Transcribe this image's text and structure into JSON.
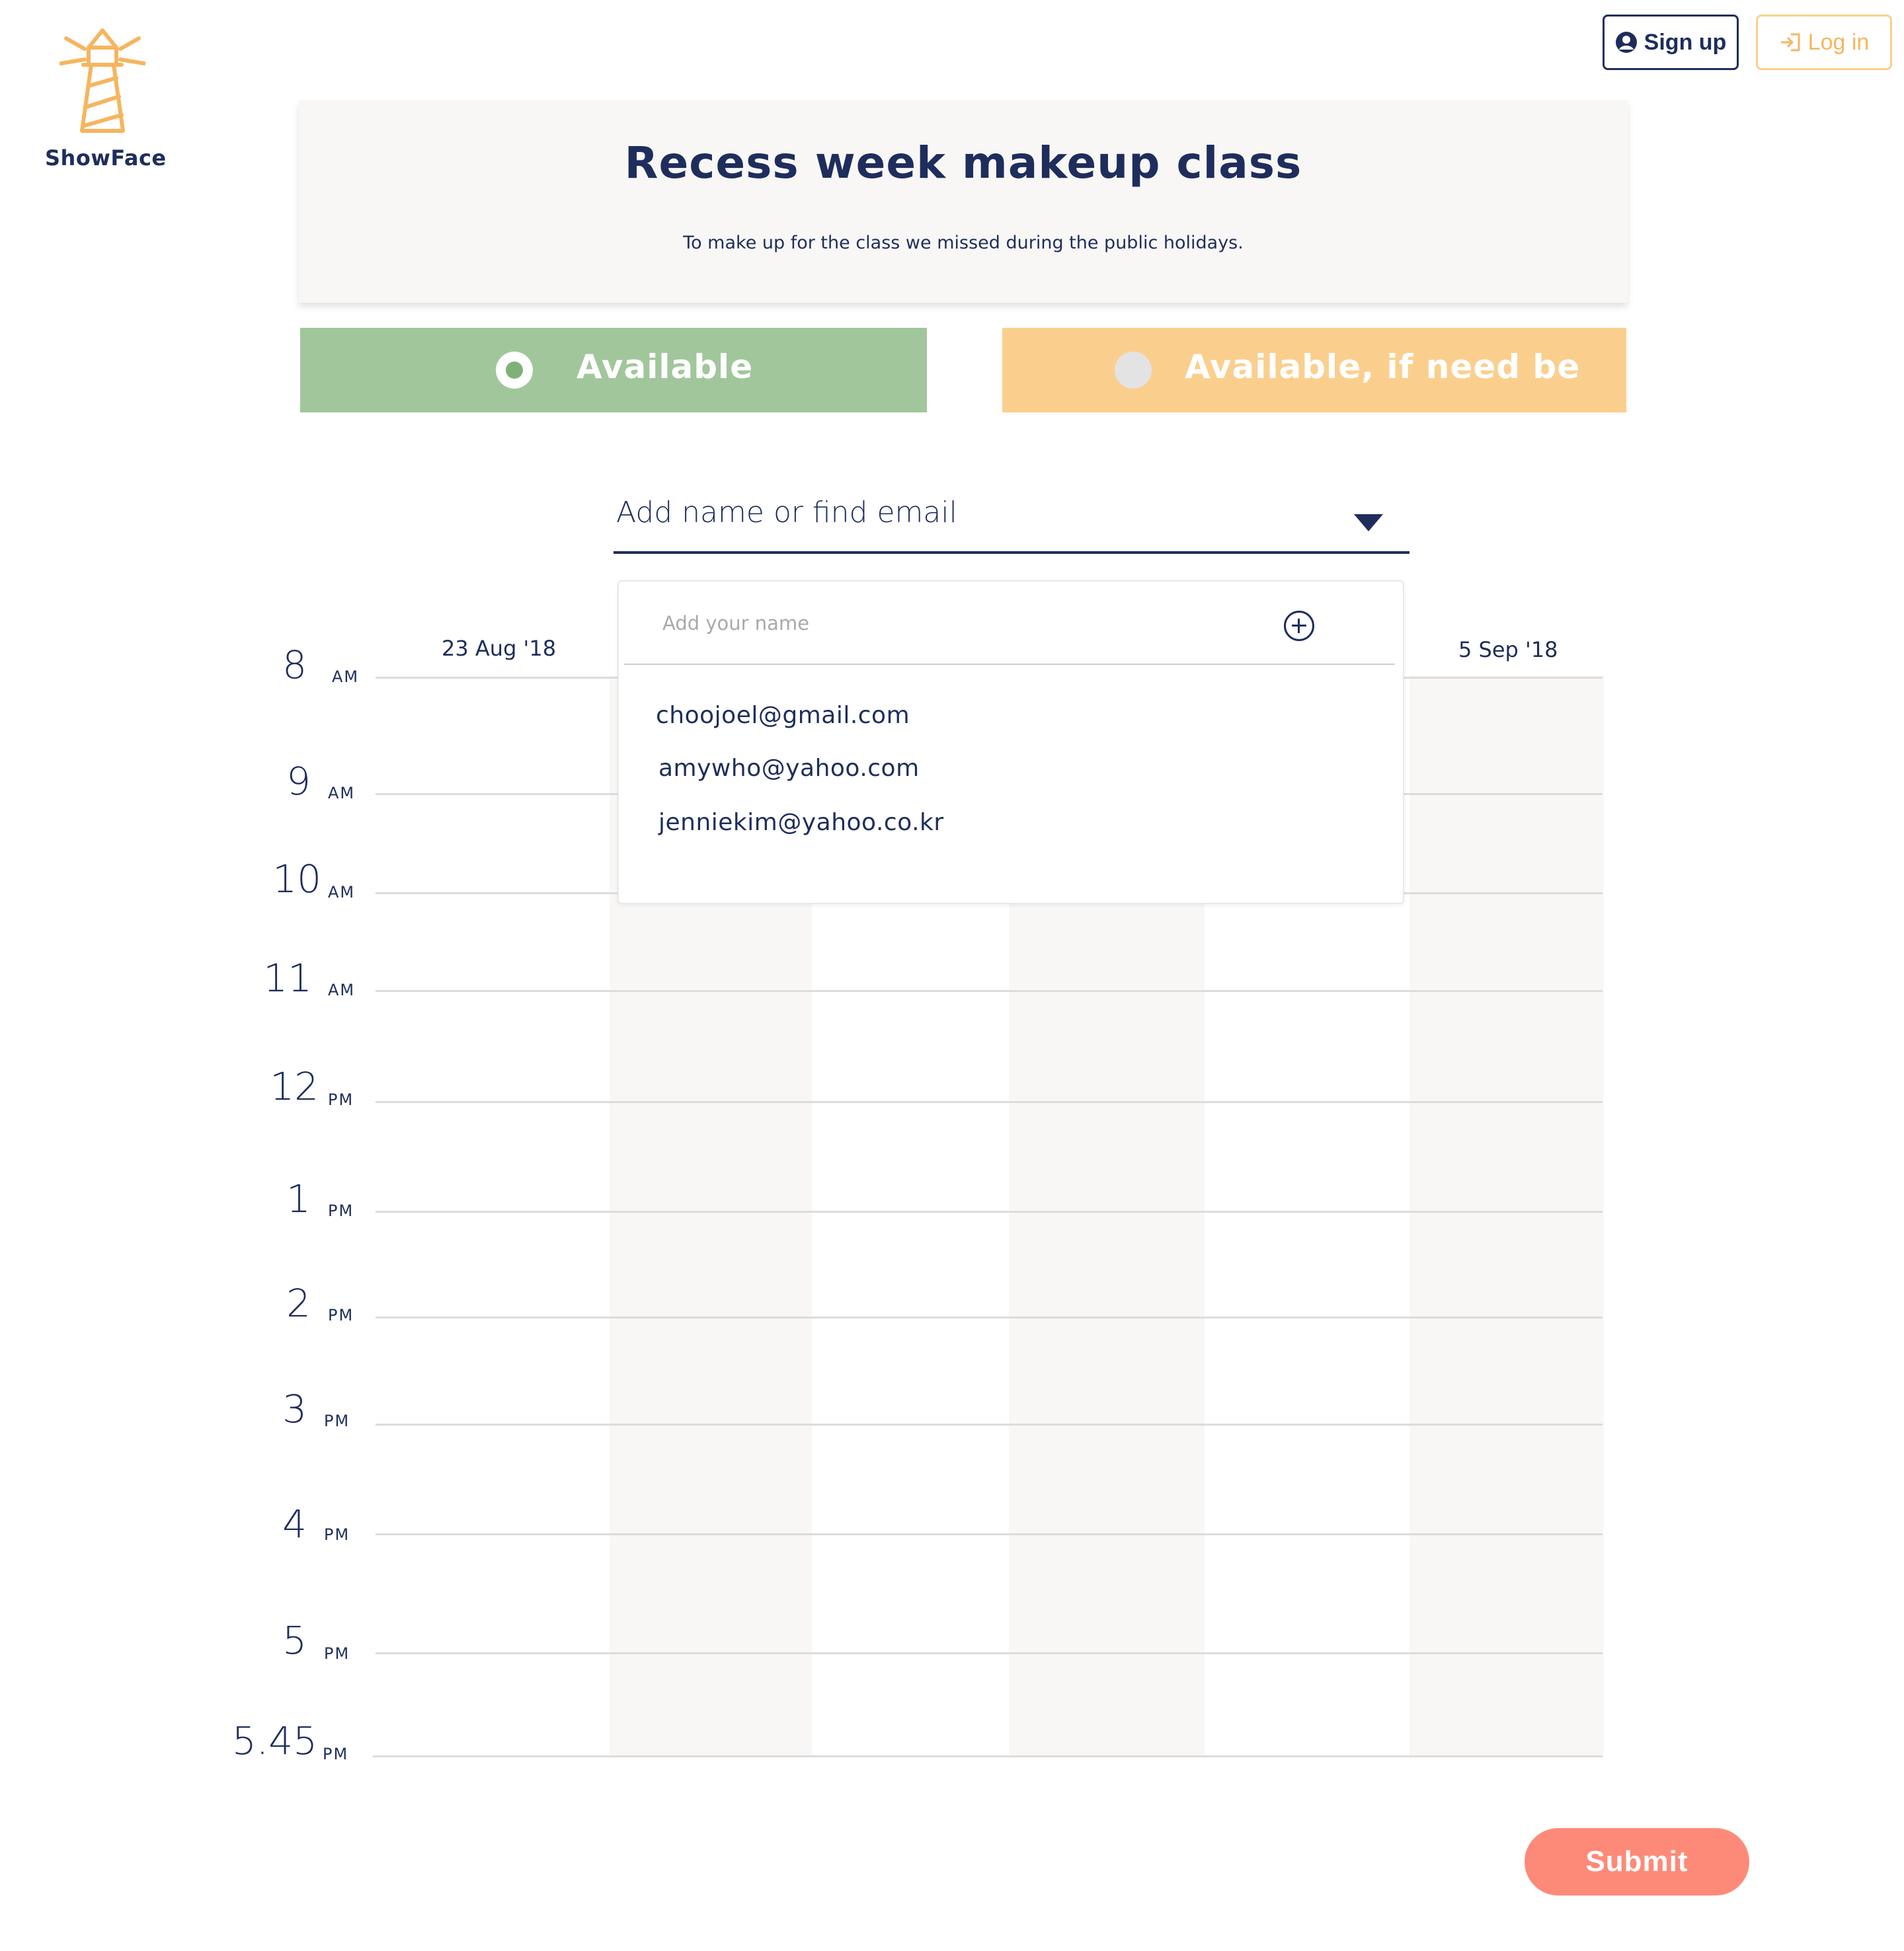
{
  "app": {
    "name": "ShowFace"
  },
  "auth": {
    "signup_label": "Sign up",
    "login_label": "Log in"
  },
  "event": {
    "title": "Recess week makeup class",
    "description": "To make up for the class we missed during the public holidays."
  },
  "availability": {
    "available_label": "Available",
    "if_need_be_label": "Available, if need be",
    "selected": "Available"
  },
  "name_select": {
    "placeholder": "Add name or find email"
  },
  "dropdown": {
    "add_placeholder": "Add your name",
    "emails": [
      "choojoel@gmail.com",
      "amywho@yahoo.com",
      "jenniekim@yahoo.co.kr"
    ]
  },
  "schedule": {
    "dates": [
      "23 Aug '18",
      "5 Sep '18"
    ],
    "hours": [
      {
        "num": "8",
        "period": "AM"
      },
      {
        "num": "9",
        "period": "AM"
      },
      {
        "num": "10",
        "period": "AM"
      },
      {
        "num": "11",
        "period": "AM"
      },
      {
        "num": "12",
        "period": "PM"
      },
      {
        "num": "1",
        "period": "PM"
      },
      {
        "num": "2",
        "period": "PM"
      },
      {
        "num": "3",
        "period": "PM"
      },
      {
        "num": "4",
        "period": "PM"
      },
      {
        "num": "5",
        "period": "PM"
      },
      {
        "num": "5.45",
        "period": "PM"
      }
    ]
  },
  "submit_label": "Submit",
  "colors": {
    "navy": "#1e2d5c",
    "available": "#a1c69b",
    "if_need_be": "#facf8e",
    "submit": "#fd8a78",
    "logo": "#f6b55f"
  }
}
